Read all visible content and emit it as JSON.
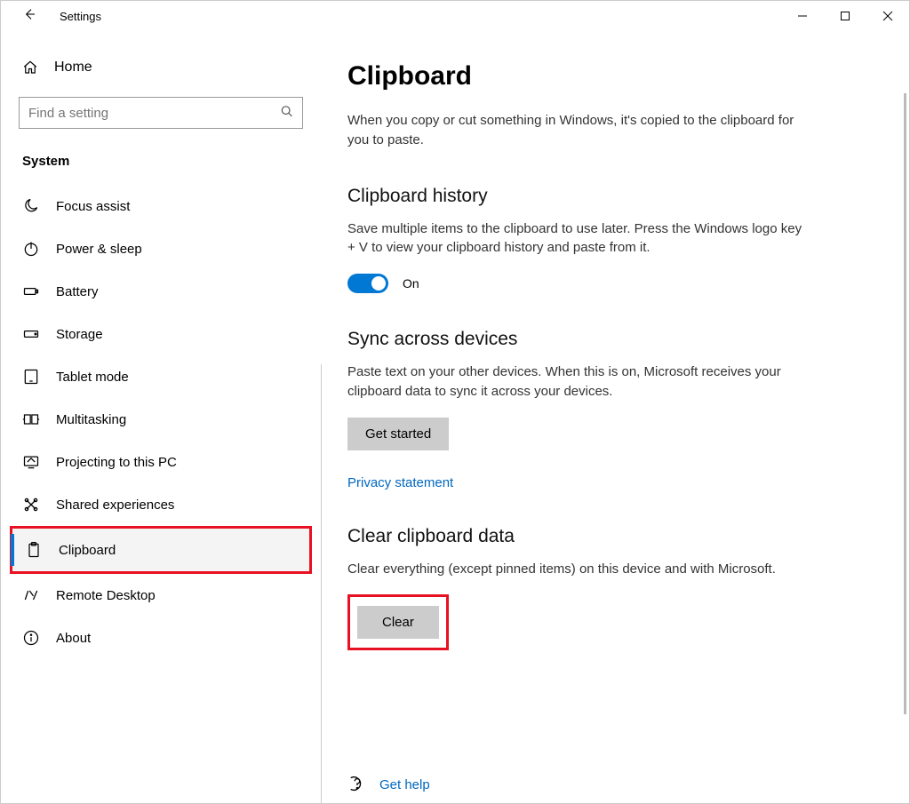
{
  "titlebar": {
    "app_title": "Settings"
  },
  "sidebar": {
    "home_label": "Home",
    "search_placeholder": "Find a setting",
    "heading": "System",
    "items": [
      {
        "label": "Focus assist"
      },
      {
        "label": "Power & sleep"
      },
      {
        "label": "Battery"
      },
      {
        "label": "Storage"
      },
      {
        "label": "Tablet mode"
      },
      {
        "label": "Multitasking"
      },
      {
        "label": "Projecting to this PC"
      },
      {
        "label": "Shared experiences"
      },
      {
        "label": "Clipboard"
      },
      {
        "label": "Remote Desktop"
      },
      {
        "label": "About"
      }
    ]
  },
  "main": {
    "page_title": "Clipboard",
    "intro": "When you copy or cut something in Windows, it's copied to the clipboard for you to paste.",
    "history": {
      "title": "Clipboard history",
      "desc": "Save multiple items to the clipboard to use later. Press the Windows logo key + V to view your clipboard history and paste from it.",
      "toggle_state": "On"
    },
    "sync": {
      "title": "Sync across devices",
      "desc": "Paste text on your other devices. When this is on, Microsoft receives your clipboard data to sync it across your devices.",
      "button_label": "Get started",
      "privacy_link": "Privacy statement"
    },
    "clear": {
      "title": "Clear clipboard data",
      "desc": "Clear everything (except pinned items) on this device and with Microsoft.",
      "button_label": "Clear"
    },
    "help_link": "Get help"
  }
}
